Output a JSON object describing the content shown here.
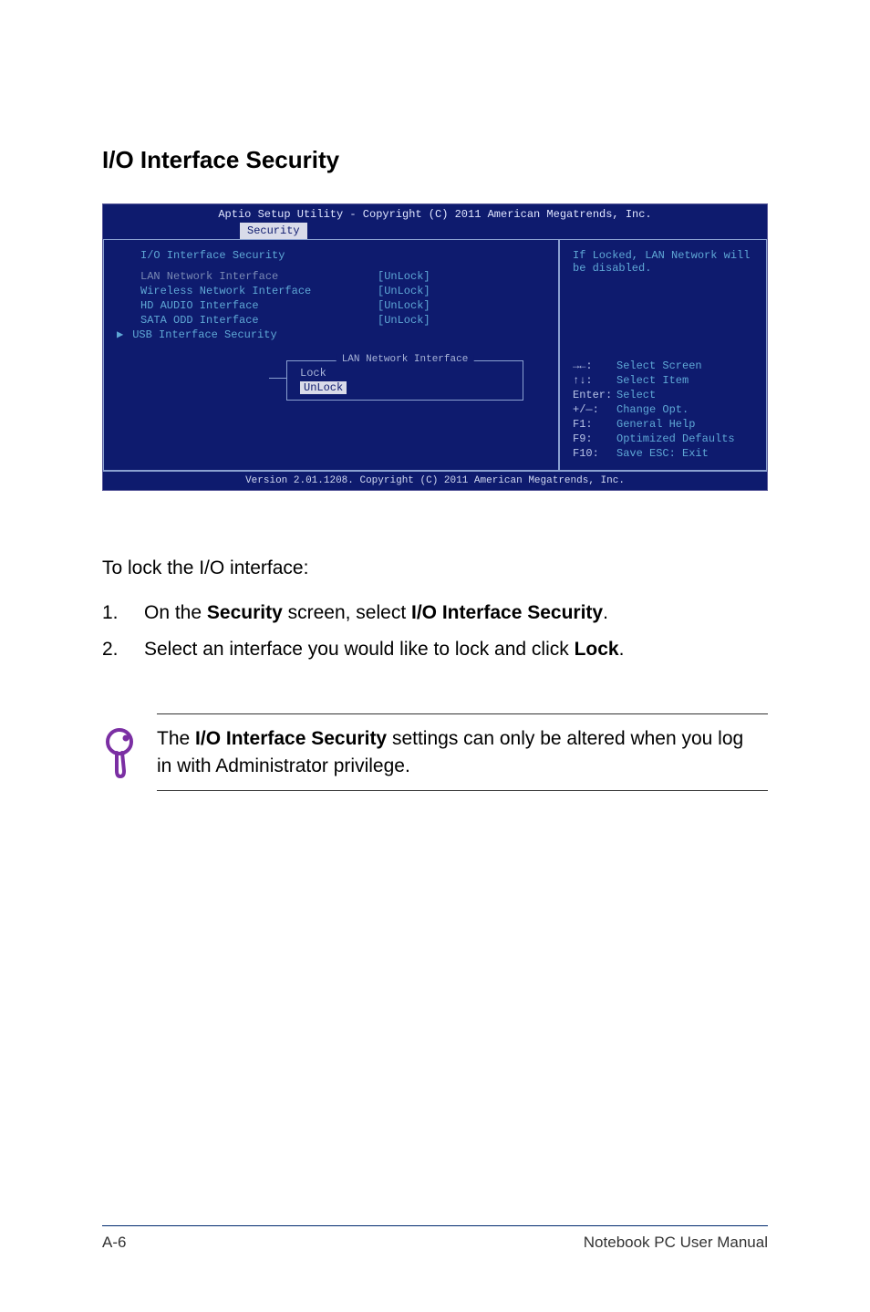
{
  "heading": "I/O Interface Security",
  "bios": {
    "header_title": "Aptio Setup Utility - Copyright (C) 2011 American Megatrends, Inc.",
    "tab": "Security",
    "section_title": "I/O Interface Security",
    "items": [
      {
        "label": "LAN Network Interface",
        "value": "[UnLock]",
        "dim": true
      },
      {
        "label": "Wireless Network Interface",
        "value": "[UnLock]"
      },
      {
        "label": "HD AUDIO Interface",
        "value": "[UnLock]"
      },
      {
        "label": "SATA ODD Interface",
        "value": "[UnLock]"
      }
    ],
    "usb_item": "USB Interface Security",
    "popup": {
      "title": "LAN Network Interface",
      "options": [
        "Lock",
        "UnLock"
      ],
      "selected": "UnLock"
    },
    "help_text": "If Locked, LAN Network will be disabled.",
    "keys": [
      {
        "k": "→←:",
        "d": "Select Screen"
      },
      {
        "k": "↑↓:",
        "d": "Select Item"
      },
      {
        "k": "Enter:",
        "d": "Select"
      },
      {
        "k": "+/—:",
        "d": "Change Opt."
      },
      {
        "k": "F1:",
        "d": "General Help"
      },
      {
        "k": "F9:",
        "d": "Optimized Defaults"
      },
      {
        "k": "F10:",
        "d": "Save   ESC: Exit"
      }
    ],
    "footer": "Version 2.01.1208. Copyright (C) 2011 American Megatrends, Inc."
  },
  "intro_text": "To lock the I/O interface:",
  "steps": [
    {
      "n": "1.",
      "pre": "On the ",
      "b1": "Security",
      "mid": " screen, select ",
      "b2": "I/O Interface Security",
      "post": "."
    },
    {
      "n": "2.",
      "pre": "Select an interface you would like to lock and click ",
      "b1": "Lock",
      "mid": "",
      "b2": "",
      "post": "."
    }
  ],
  "note": {
    "pre": "The ",
    "b": "I/O Interface Security",
    "post": " settings can only be altered when you log in with Administrator privilege."
  },
  "footer": {
    "left": "A-6",
    "right": "Notebook PC User Manual"
  }
}
